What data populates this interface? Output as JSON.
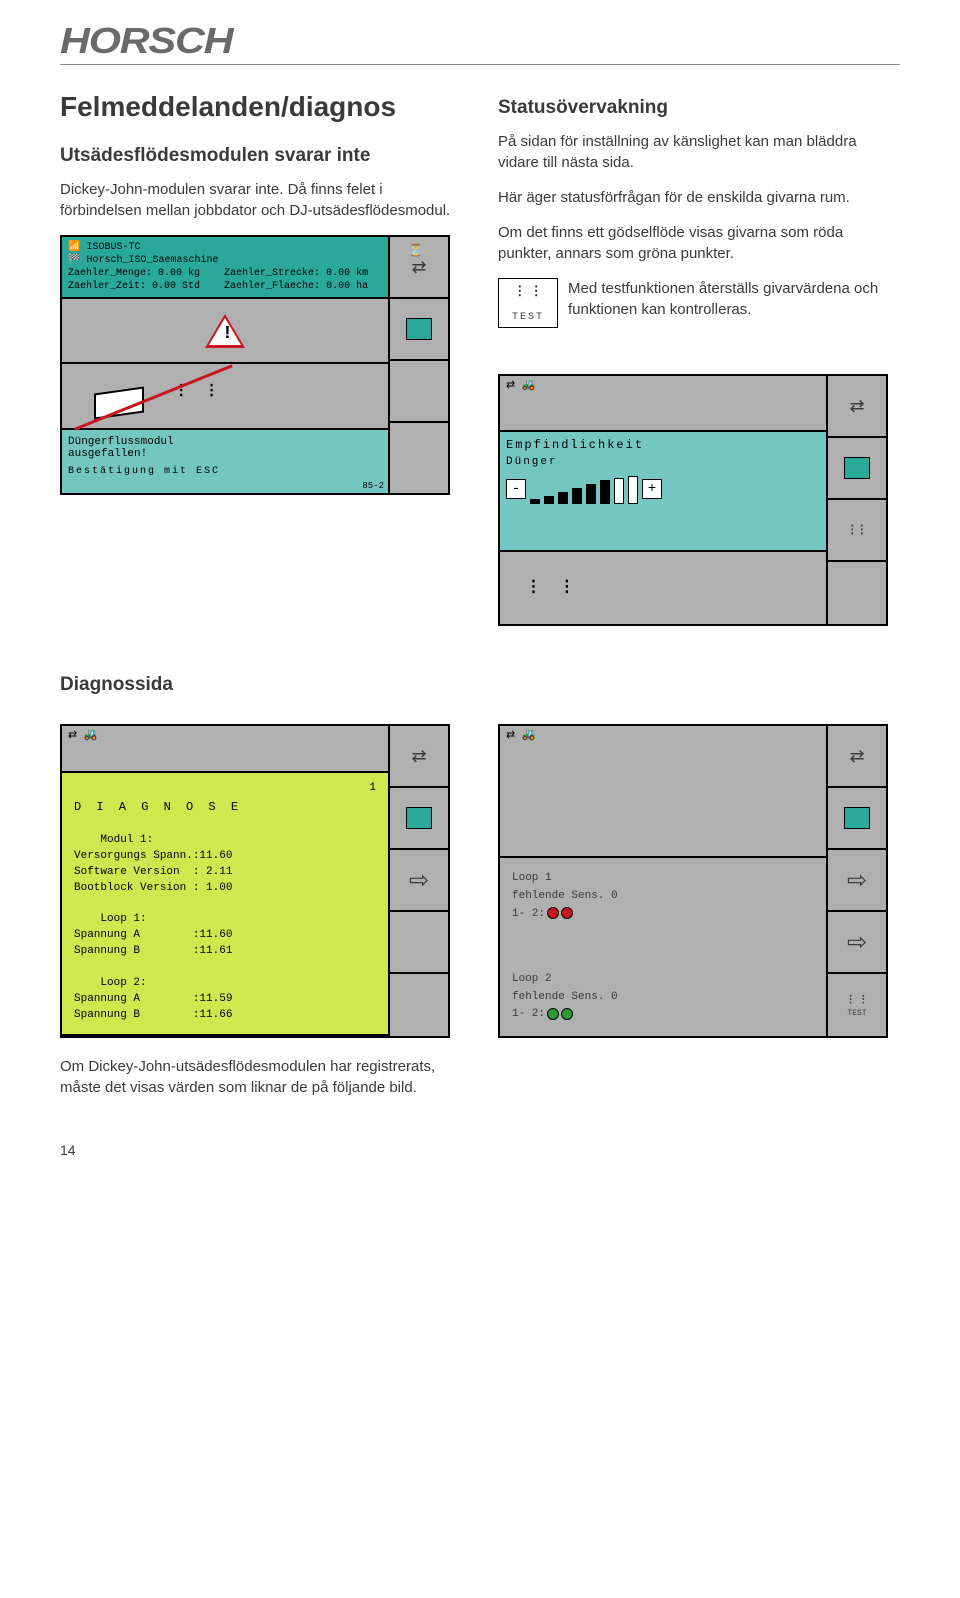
{
  "brand": "HORSCH",
  "page_number": "14",
  "left": {
    "h1": "Felmeddelanden/diagnos",
    "h2": "Utsädesflödesmodulen svarar inte",
    "p1": "Dickey-John-modulen svarar inte. Då finns felet i förbindelsen mellan jobbdator och DJ-utsädesflödesmodul.",
    "diag_heading": "Diagnossida",
    "footer_p": "Om Dickey-John-utsädesflödesmodulen har registrerats, måste det visas värden som liknar de på följande bild."
  },
  "right": {
    "h2": "Statusövervakning",
    "p1": "På sidan för inställning av känslighet kan man bläddra vidare till nästa sida.",
    "p2": "Här äger statusförfrågan för de enskilda givarna rum.",
    "p3": "Om det finns ett gödselflöde visas givarna som röda punkter, annars som gröna punkter.",
    "p4": "Med testfunktionen återställs givarvärdena och funktionen kan kontrolleras.",
    "test_label": "TEST"
  },
  "screen1": {
    "hdr_line1": "ISOBUS-TC",
    "hdr_line2": "Horsch_ISO_Saemaschine",
    "hdr_line3a": "Zaehler_Menge: 0.00 kg",
    "hdr_line3b": "Zaehler_Strecke: 0.00 km",
    "hdr_line4a": "Zaehler_Zeit: 0.00 Std",
    "hdr_line4b": "Zaehler_Flaeche: 0.00 ha",
    "msg1": "Düngerflussmodul",
    "msg2": "ausgefallen!",
    "esc": "Bestätigung mit ESC",
    "corner": "85-2"
  },
  "screen2": {
    "title": "Empfindlichkeit",
    "sub": "Dünger",
    "minus": "-",
    "plus": "+"
  },
  "screen3": {
    "title": "D I A G N O S E",
    "page": "1",
    "body": "    Modul 1:\nVersorgungs Spann.:11.60\nSoftware Version  : 2.11\nBootblock Version : 1.00\n\n    Loop 1:\nSpannung A        :11.60\nSpannung B        :11.61\n\n    Loop 2:\nSpannung A        :11.59\nSpannung B        :11.66"
  },
  "screen4": {
    "loop1_l1": "    Loop      1",
    "loop1_l2": "fehlende Sens. 0",
    "loop1_l3": " 1- 2:",
    "loop2_l1": "    Loop      2",
    "loop2_l2": "fehlende Sens. 0",
    "loop2_l3": " 1- 2:",
    "test": "TEST"
  }
}
